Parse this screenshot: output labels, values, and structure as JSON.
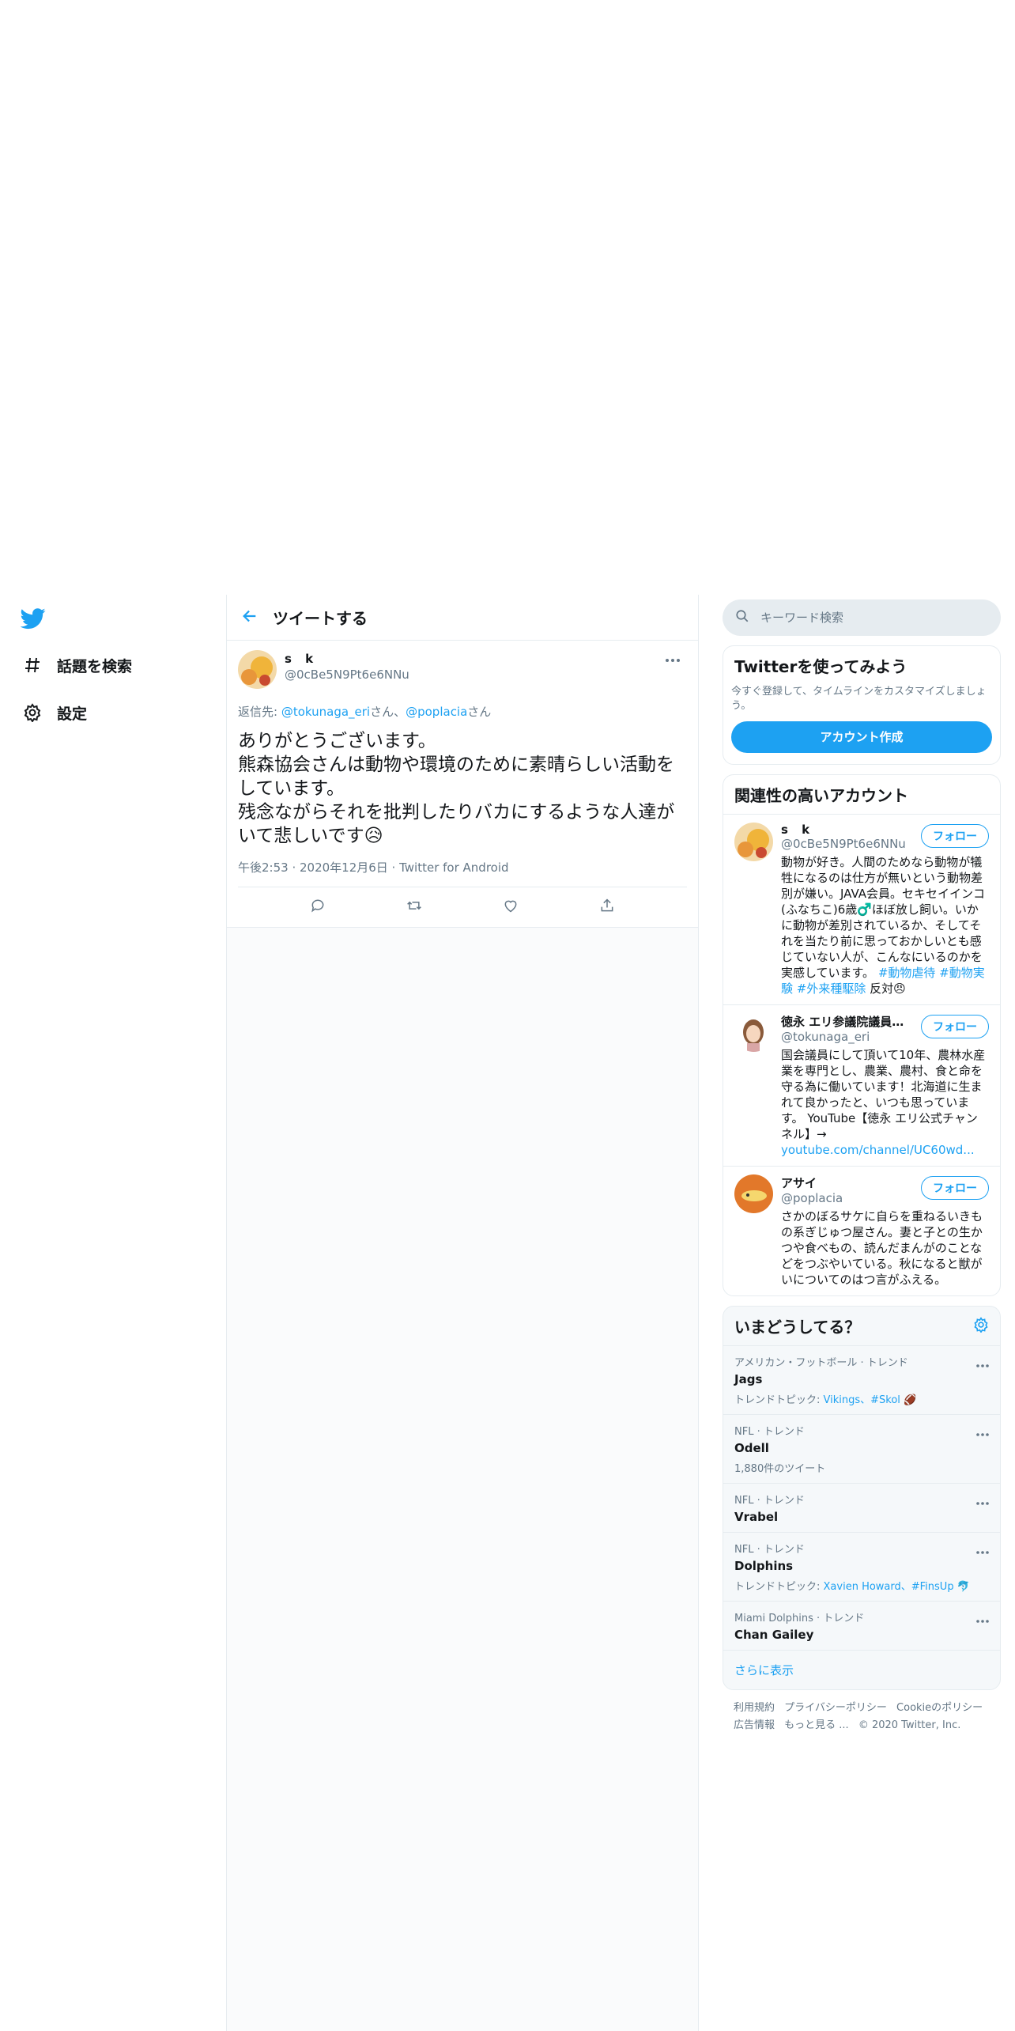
{
  "nav": {
    "items": [
      {
        "label": "話題を検索",
        "icon": "hashtag-icon"
      },
      {
        "label": "設定",
        "icon": "gear-icon"
      }
    ]
  },
  "main": {
    "title": "ツイートする"
  },
  "tweet": {
    "display_name": "s k",
    "handle": "@0cBe5N9Pt6e6NNu",
    "reply_prefix": "返信先: ",
    "reply_user1": "@tokunaga_eri",
    "reply_mid": "さん、",
    "reply_user2": "@poplacia",
    "reply_suffix": "さん",
    "body": "ありがとうございます。\n熊森協会さんは動物や環境のために素晴らしい活動をしています。\n残念ながらそれを批判したりバカにするような人達がいて悲しいです😥",
    "meta": "午後2:53 · 2020年12月6日 · Twitter for Android"
  },
  "search": {
    "placeholder": "キーワード検索"
  },
  "signup": {
    "title": "Twitterを使ってみよう",
    "subtitle": "今すぐ登録して、タイムラインをカスタマイズしましょう。",
    "button": "アカウント作成"
  },
  "relevant": {
    "title": "関連性の高いアカウント",
    "follow_label": "フォロー",
    "accounts": [
      {
        "name": "s k",
        "handle": "@0cBe5N9Pt6e6NNu",
        "bio": "動物が好き。人間のためなら動物が犠牲になるのは仕方が無いという動物差別が嫌い。JAVA会員。セキセイインコ(ふなちこ)6歳♂️ほぼ放し飼い。いかに動物が差別されているか、そしてそれを当たり前に思っておかしいとも感じていない人が、こんなにいるのかを実感しています。",
        "tags": "#動物虐待 #動物実験 #外来種駆除",
        "tail": " 反対😠"
      },
      {
        "name": "徳永 エリ参議院議員…",
        "handle": "@tokunaga_eri",
        "bio": "国会議員にして頂いて10年、農林水産業を専門とし、農業、農村、食と命を守る為に働いています！北海道に生まれて良かったと、いつも思っています。 YouTube【徳永 エリ公式チャンネル】→",
        "link": "youtube.com/channel/UC60wd..."
      },
      {
        "name": "アサイ",
        "handle": "@poplacia",
        "bio": "さかのぼるサケに自らを重ねるいきもの系ぎじゅつ屋さん。妻と子との生かつや食べもの、読んだまんがのことなどをつぶやいている。秋になると獣がいについてのはつ言がふえる。"
      }
    ]
  },
  "trends": {
    "title": "いまどうしてる？",
    "items": [
      {
        "context": "アメリカン・フットボール · トレンド",
        "name": "Jags",
        "extra_prefix": "トレンドトピック: ",
        "extra_links": "Vikings、#Skol 🏈"
      },
      {
        "context": "NFL · トレンド",
        "name": "Odell",
        "extra_plain": "1,880件のツイート"
      },
      {
        "context": "NFL · トレンド",
        "name": "Vrabel"
      },
      {
        "context": "NFL · トレンド",
        "name": "Dolphins",
        "extra_prefix": "トレンドトピック: ",
        "extra_links": "Xavien Howard、#FinsUp 🐬"
      },
      {
        "context": "Miami Dolphins · トレンド",
        "name": "Chan Gailey"
      }
    ],
    "show_more": "さらに表示"
  },
  "footer": {
    "links": [
      "利用規約",
      "プライバシーポリシー",
      "Cookieのポリシー",
      "広告情報",
      "もっと見る ..."
    ],
    "copyright": "© 2020 Twitter, Inc."
  },
  "colors": {
    "accent": "#1da1f2",
    "secondary_text": "#657786",
    "border": "#e6ecf0"
  }
}
